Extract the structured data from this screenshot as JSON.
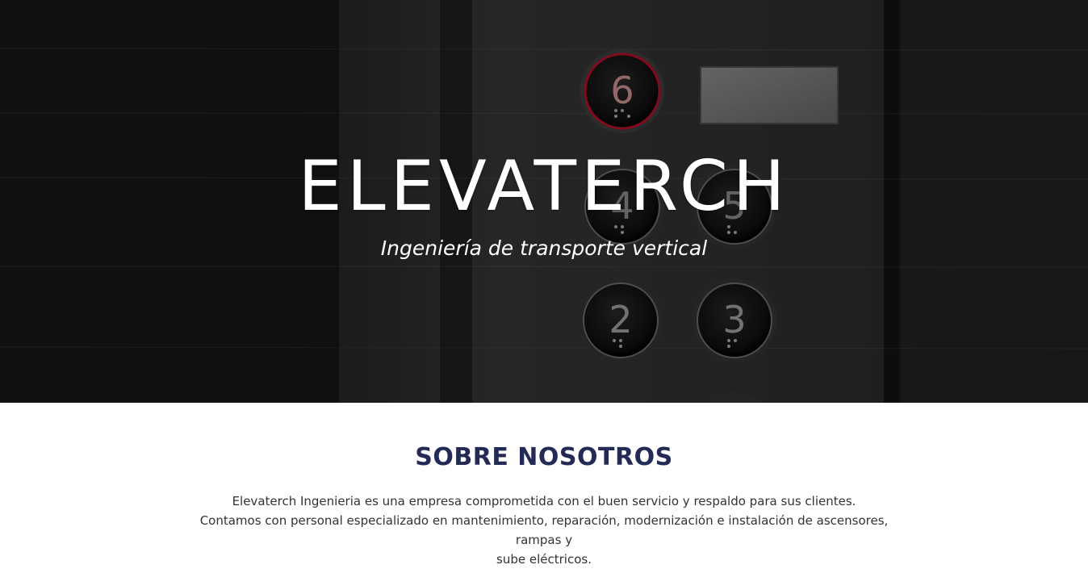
{
  "hero": {
    "title": "ELEVATERCH",
    "subtitle": "Ingeniería de transporte vertical",
    "buttons": [
      "6",
      "4",
      "5",
      "2",
      "3"
    ]
  },
  "about": {
    "title": "SOBRE NOSOTROS",
    "line1": "Elevaterch Ingenieria es una empresa comprometida con el buen servicio y respaldo para sus clientes.",
    "line2": "Contamos con personal especializado en mantenimiento, reparación, modernización e instalación de ascensores, rampas y",
    "line3": "sube eléctricos."
  },
  "colors": {
    "accent": "#232a55",
    "hero_text": "#ffffff",
    "active_ring": "#c8102e"
  }
}
